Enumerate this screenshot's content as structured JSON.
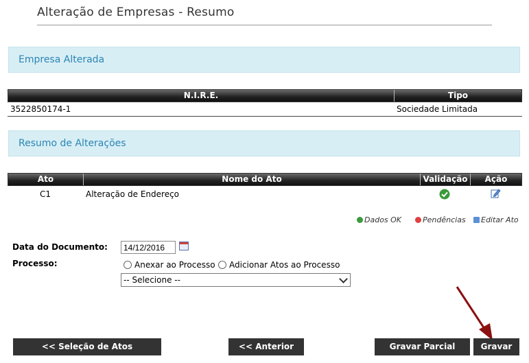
{
  "header": {
    "title": "Alteração de Empresas - Resumo"
  },
  "empresa_section": {
    "title": "Empresa Alterada"
  },
  "empresa_table": {
    "columns": [
      "N.I.R.E.",
      "Tipo"
    ],
    "rows": [
      {
        "nire": "3522850174-1",
        "tipo": "Sociedade Limitada"
      }
    ]
  },
  "resumo_section": {
    "title": "Resumo de Alterações"
  },
  "atos_table": {
    "columns": [
      "Ato",
      "Nome do Ato",
      "Validação",
      "Ação"
    ],
    "rows": [
      {
        "ato": "C1",
        "nome": "Alteração de Endereço",
        "validacao_icon": "check-circle-icon",
        "acao_icon": "edit-icon"
      }
    ]
  },
  "legend": {
    "ok": "Dados OK",
    "pendencias": "Pendências",
    "editar": "Editar Ato"
  },
  "form": {
    "data_label": "Data do Documento:",
    "data_value": "14/12/2016",
    "processo_label": "Processo:",
    "radio_anexar": "Anexar ao Processo",
    "radio_adicionar": "Adicionar Atos ao Processo",
    "select_value": "-- Selecione --"
  },
  "buttons": {
    "selecao": "<< Seleção de Atos",
    "anterior": "<< Anterior",
    "gravar_parcial": "Gravar Parcial",
    "gravar": "Gravar"
  },
  "colors": {
    "section_bg": "#d8eef5",
    "section_text": "#2a86b4",
    "button_bg": "#333333",
    "arrow": "#8b1010",
    "ok": "#3a9a3a",
    "pend": "#e04040"
  }
}
